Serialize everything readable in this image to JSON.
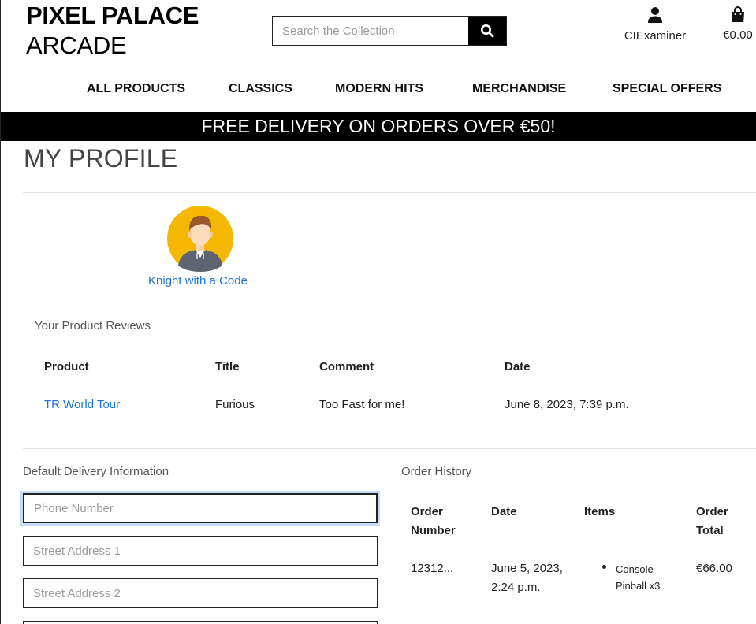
{
  "header": {
    "logo_line1": "PIXEL PALACE",
    "logo_line2": "ARCADE",
    "search_placeholder": "Search the Collection",
    "account_label": "CIExaminer",
    "bag_total": "€0.00"
  },
  "nav": {
    "items": [
      "ALL PRODUCTS",
      "CLASSICS",
      "MODERN HITS",
      "MERCHANDISE",
      "SPECIAL OFFERS"
    ]
  },
  "banner": {
    "text": "FREE DELIVERY ON ORDERS OVER €50!"
  },
  "profile": {
    "title": "MY PROFILE",
    "avatar_name": "Knight with a Code"
  },
  "reviews": {
    "heading": "Your Product Reviews",
    "columns": [
      "Product",
      "Title",
      "Comment",
      "Date"
    ],
    "rows": [
      {
        "product": "TR World Tour",
        "title": "Furious",
        "comment": "Too Fast for me!",
        "date": "June 8, 2023, 7:39 p.m."
      }
    ]
  },
  "delivery": {
    "heading": "Default Delivery Information",
    "fields": [
      {
        "placeholder": "Phone Number"
      },
      {
        "placeholder": "Street Address 1"
      },
      {
        "placeholder": "Street Address 2"
      }
    ]
  },
  "orders": {
    "heading": "Order History",
    "columns": {
      "number_1": "Order",
      "number_2": "Number",
      "date": "Date",
      "items": "Items",
      "total_1": "Order",
      "total_2": "Total"
    },
    "rows": [
      {
        "number": "12312...",
        "date_1": "June 5, 2023,",
        "date_2": "2:24 p.m.",
        "item_1": "Console",
        "item_2": "Pinball x3",
        "total": "€66.00"
      }
    ]
  },
  "colors": {
    "link": "#1a73d9",
    "banner_bg": "#000000",
    "avatar_bg": "#f5b800"
  }
}
